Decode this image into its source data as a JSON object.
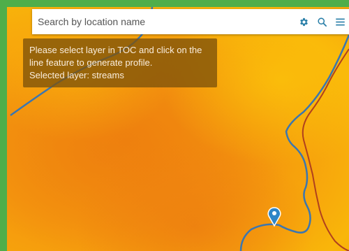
{
  "search": {
    "placeholder": "Search by location name"
  },
  "toolbar": {
    "icons": [
      "gear-icon",
      "search-icon",
      "menu-icon"
    ]
  },
  "info": {
    "line1": "Please select layer in TOC and click on the",
    "line2": "line feature to generate profile.",
    "line3": "Selected layer: streams"
  },
  "colors": {
    "frame": "#4fae4a",
    "stream": "#3b76b0",
    "boundary": "#b0401e",
    "marker": "#2f86c7",
    "accent": "#2a7fa8"
  }
}
